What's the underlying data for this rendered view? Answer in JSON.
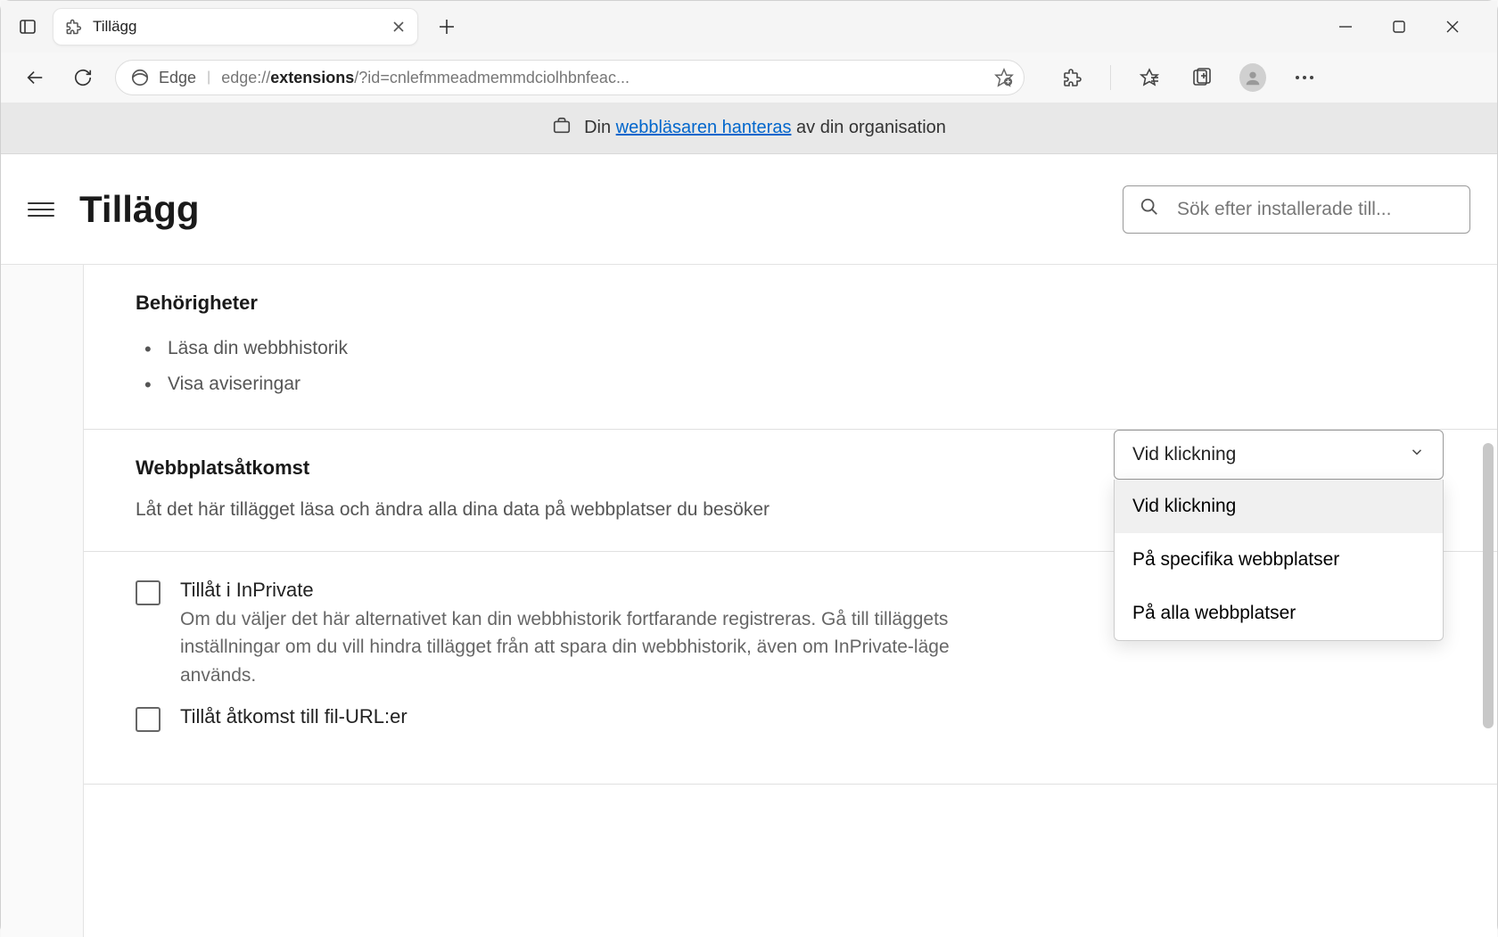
{
  "tab": {
    "title": "Tillägg"
  },
  "address": {
    "brand": "Edge",
    "url_base": "edge://",
    "url_bold": "extensions",
    "url_rest": "/?id=cnlefmmeadmemmdciolhbnfeac..."
  },
  "managed": {
    "prefix": "Din ",
    "link": "webbläsaren hanteras",
    "suffix": " av din organisation"
  },
  "header": {
    "title": "Tillägg",
    "search_placeholder": "Sök efter installerade till..."
  },
  "sections": {
    "permissions": {
      "title": "Behörigheter",
      "items": [
        "Läsa din webbhistorik",
        "Visa aviseringar"
      ]
    },
    "site_access": {
      "title": "Webbplatsåtkomst",
      "desc": "Låt det här tillägget läsa och ändra alla dina data på webbplatser du besöker",
      "dropdown_selected": "Vid klickning",
      "dropdown_options": [
        "Vid klickning",
        "På specifika webbplatser",
        "På alla webbplatser"
      ]
    },
    "inprivate": {
      "label": "Tillåt i InPrivate",
      "desc": "Om du väljer det här alternativet kan din webbhistorik fortfarande registreras. Gå till tilläggets inställningar om du vill hindra tillägget från att spara din webbhistorik, även om InPrivate-läge används."
    },
    "file_urls": {
      "label": "Tillåt åtkomst till fil-URL:er"
    }
  }
}
